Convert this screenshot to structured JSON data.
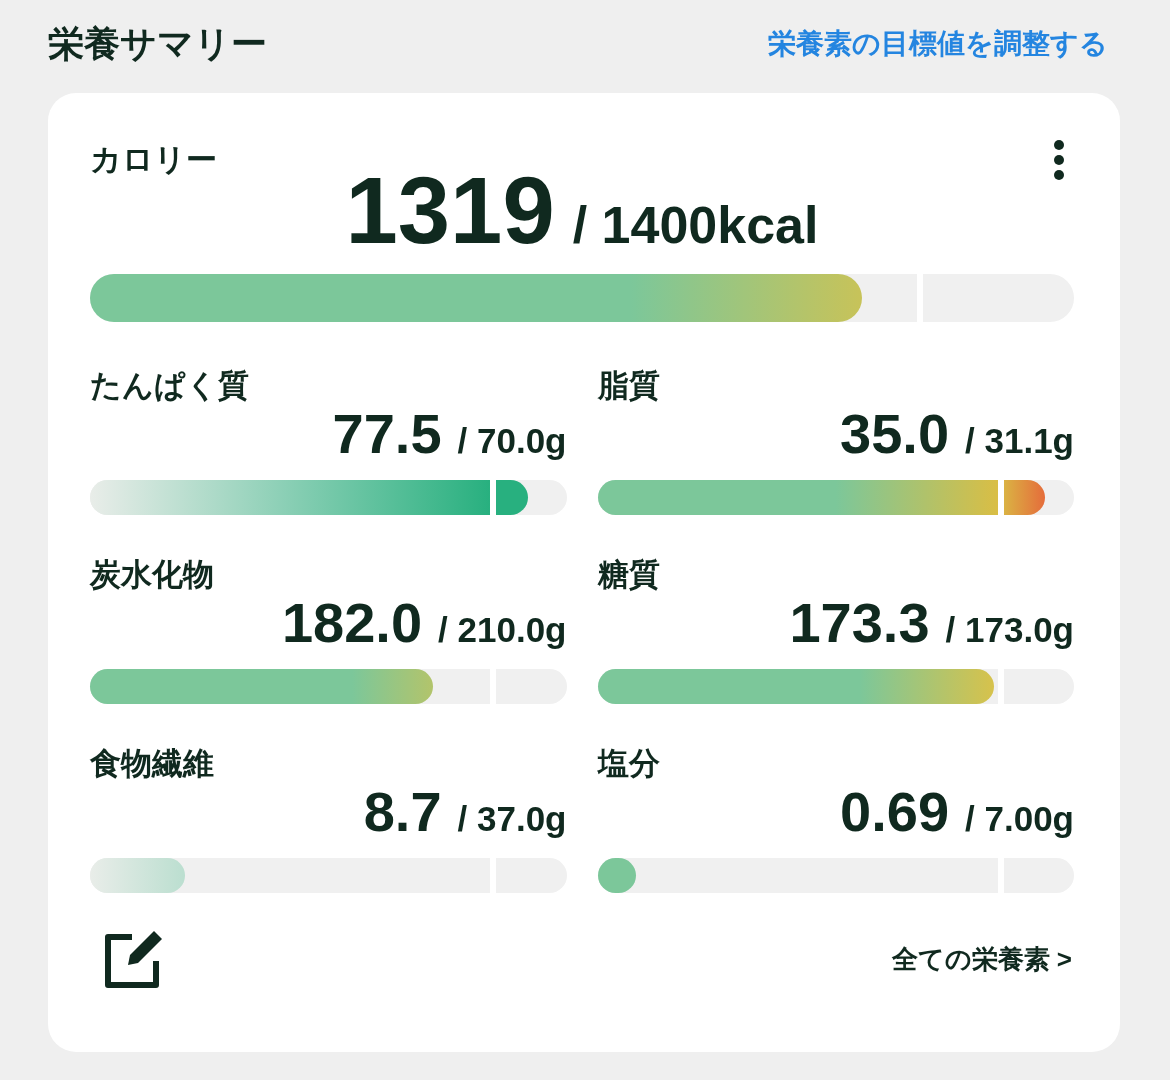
{
  "header": {
    "title": "栄養サマリー",
    "link": "栄養素の目標値を調整する"
  },
  "calorie": {
    "label": "カロリー",
    "value": "1319",
    "target": "/ 1400kcal",
    "level": 0.785,
    "kind": "warm"
  },
  "nutrients": [
    {
      "label": "たんぱく質",
      "value": "77.5",
      "target": "/ 70.0g",
      "level": 0.92,
      "kind": "fade"
    },
    {
      "label": "脂質",
      "value": "35.0",
      "target": "/ 31.1g",
      "level": 0.94,
      "kind": "hot"
    },
    {
      "label": "炭水化物",
      "value": "182.0",
      "target": "/ 210.0g",
      "level": 0.72,
      "kind": "warm"
    },
    {
      "label": "糖質",
      "value": "173.3",
      "target": "/ 173.0g",
      "level": 0.833,
      "kind": "warm"
    },
    {
      "label": "食物繊維",
      "value": "8.7",
      "target": "/ 37.0g",
      "level": 0.2,
      "kind": "fade"
    },
    {
      "label": "塩分",
      "value": "0.69",
      "target": "/ 7.00g",
      "level": 0.08,
      "kind": "warm"
    }
  ],
  "footer": {
    "link": "全ての栄養素 >"
  }
}
